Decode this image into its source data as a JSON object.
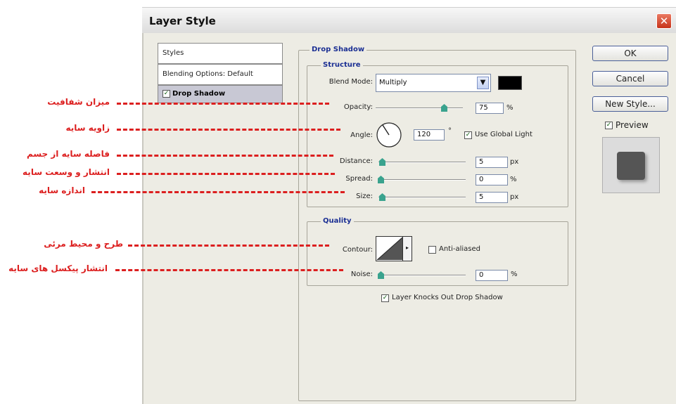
{
  "window": {
    "title": "Layer Style",
    "close_glyph": "✕"
  },
  "styles_list": [
    {
      "label": "Styles",
      "selected": false,
      "checkbox": false
    },
    {
      "label": "Blending Options: Default",
      "selected": false,
      "checkbox": false
    },
    {
      "label": "Drop Shadow",
      "selected": true,
      "checkbox": true,
      "checked": true
    }
  ],
  "panel": {
    "title": "Drop Shadow",
    "structure": {
      "title": "Structure",
      "blend_mode": {
        "label": "Blend Mode:",
        "value": "Multiply",
        "color": "#000000"
      },
      "opacity": {
        "label": "Opacity:",
        "value": "75",
        "unit": "%",
        "slider_fraction": 0.75
      },
      "angle": {
        "label": "Angle:",
        "value": "120",
        "unit": "°",
        "global_light_label": "Use Global Light",
        "global_light_checked": true,
        "dial_degrees": 120
      },
      "distance": {
        "label": "Distance:",
        "value": "5",
        "unit": "px",
        "slider_fraction": 0.02
      },
      "spread": {
        "label": "Spread:",
        "value": "0",
        "unit": "%",
        "slider_fraction": 0.0
      },
      "size": {
        "label": "Size:",
        "value": "5",
        "unit": "px",
        "slider_fraction": 0.02
      }
    },
    "quality": {
      "title": "Quality",
      "contour": {
        "label": "Contour:",
        "anti_aliased_label": "Anti-aliased",
        "anti_aliased_checked": false
      },
      "noise": {
        "label": "Noise:",
        "value": "0",
        "unit": "%",
        "slider_fraction": 0.0
      }
    },
    "knockout": {
      "label": "Layer Knocks Out Drop Shadow",
      "checked": true
    }
  },
  "buttons": {
    "ok": "OK",
    "cancel": "Cancel",
    "new_style": "New Style...",
    "preview_label": "Preview",
    "preview_checked": true
  },
  "annotations": [
    "میزان شفافیت",
    "زاویه سایه",
    "فاصله سایه از جسم",
    "انتشار و وسعت سایه",
    "اندازه سایه",
    "طرح و محیط مرئی",
    "انتشار پیکسل های سایه"
  ],
  "colors": {
    "annotation": "#dc1f1f",
    "legend": "#1b2f93",
    "slider_thumb": "#3aa38e",
    "dialog_bg": "#edece4"
  },
  "icons": {
    "close": "close-icon",
    "dropdown": "chevron-down-icon",
    "angle_dial": "angle-dial-icon",
    "contour": "contour-curve-icon"
  }
}
